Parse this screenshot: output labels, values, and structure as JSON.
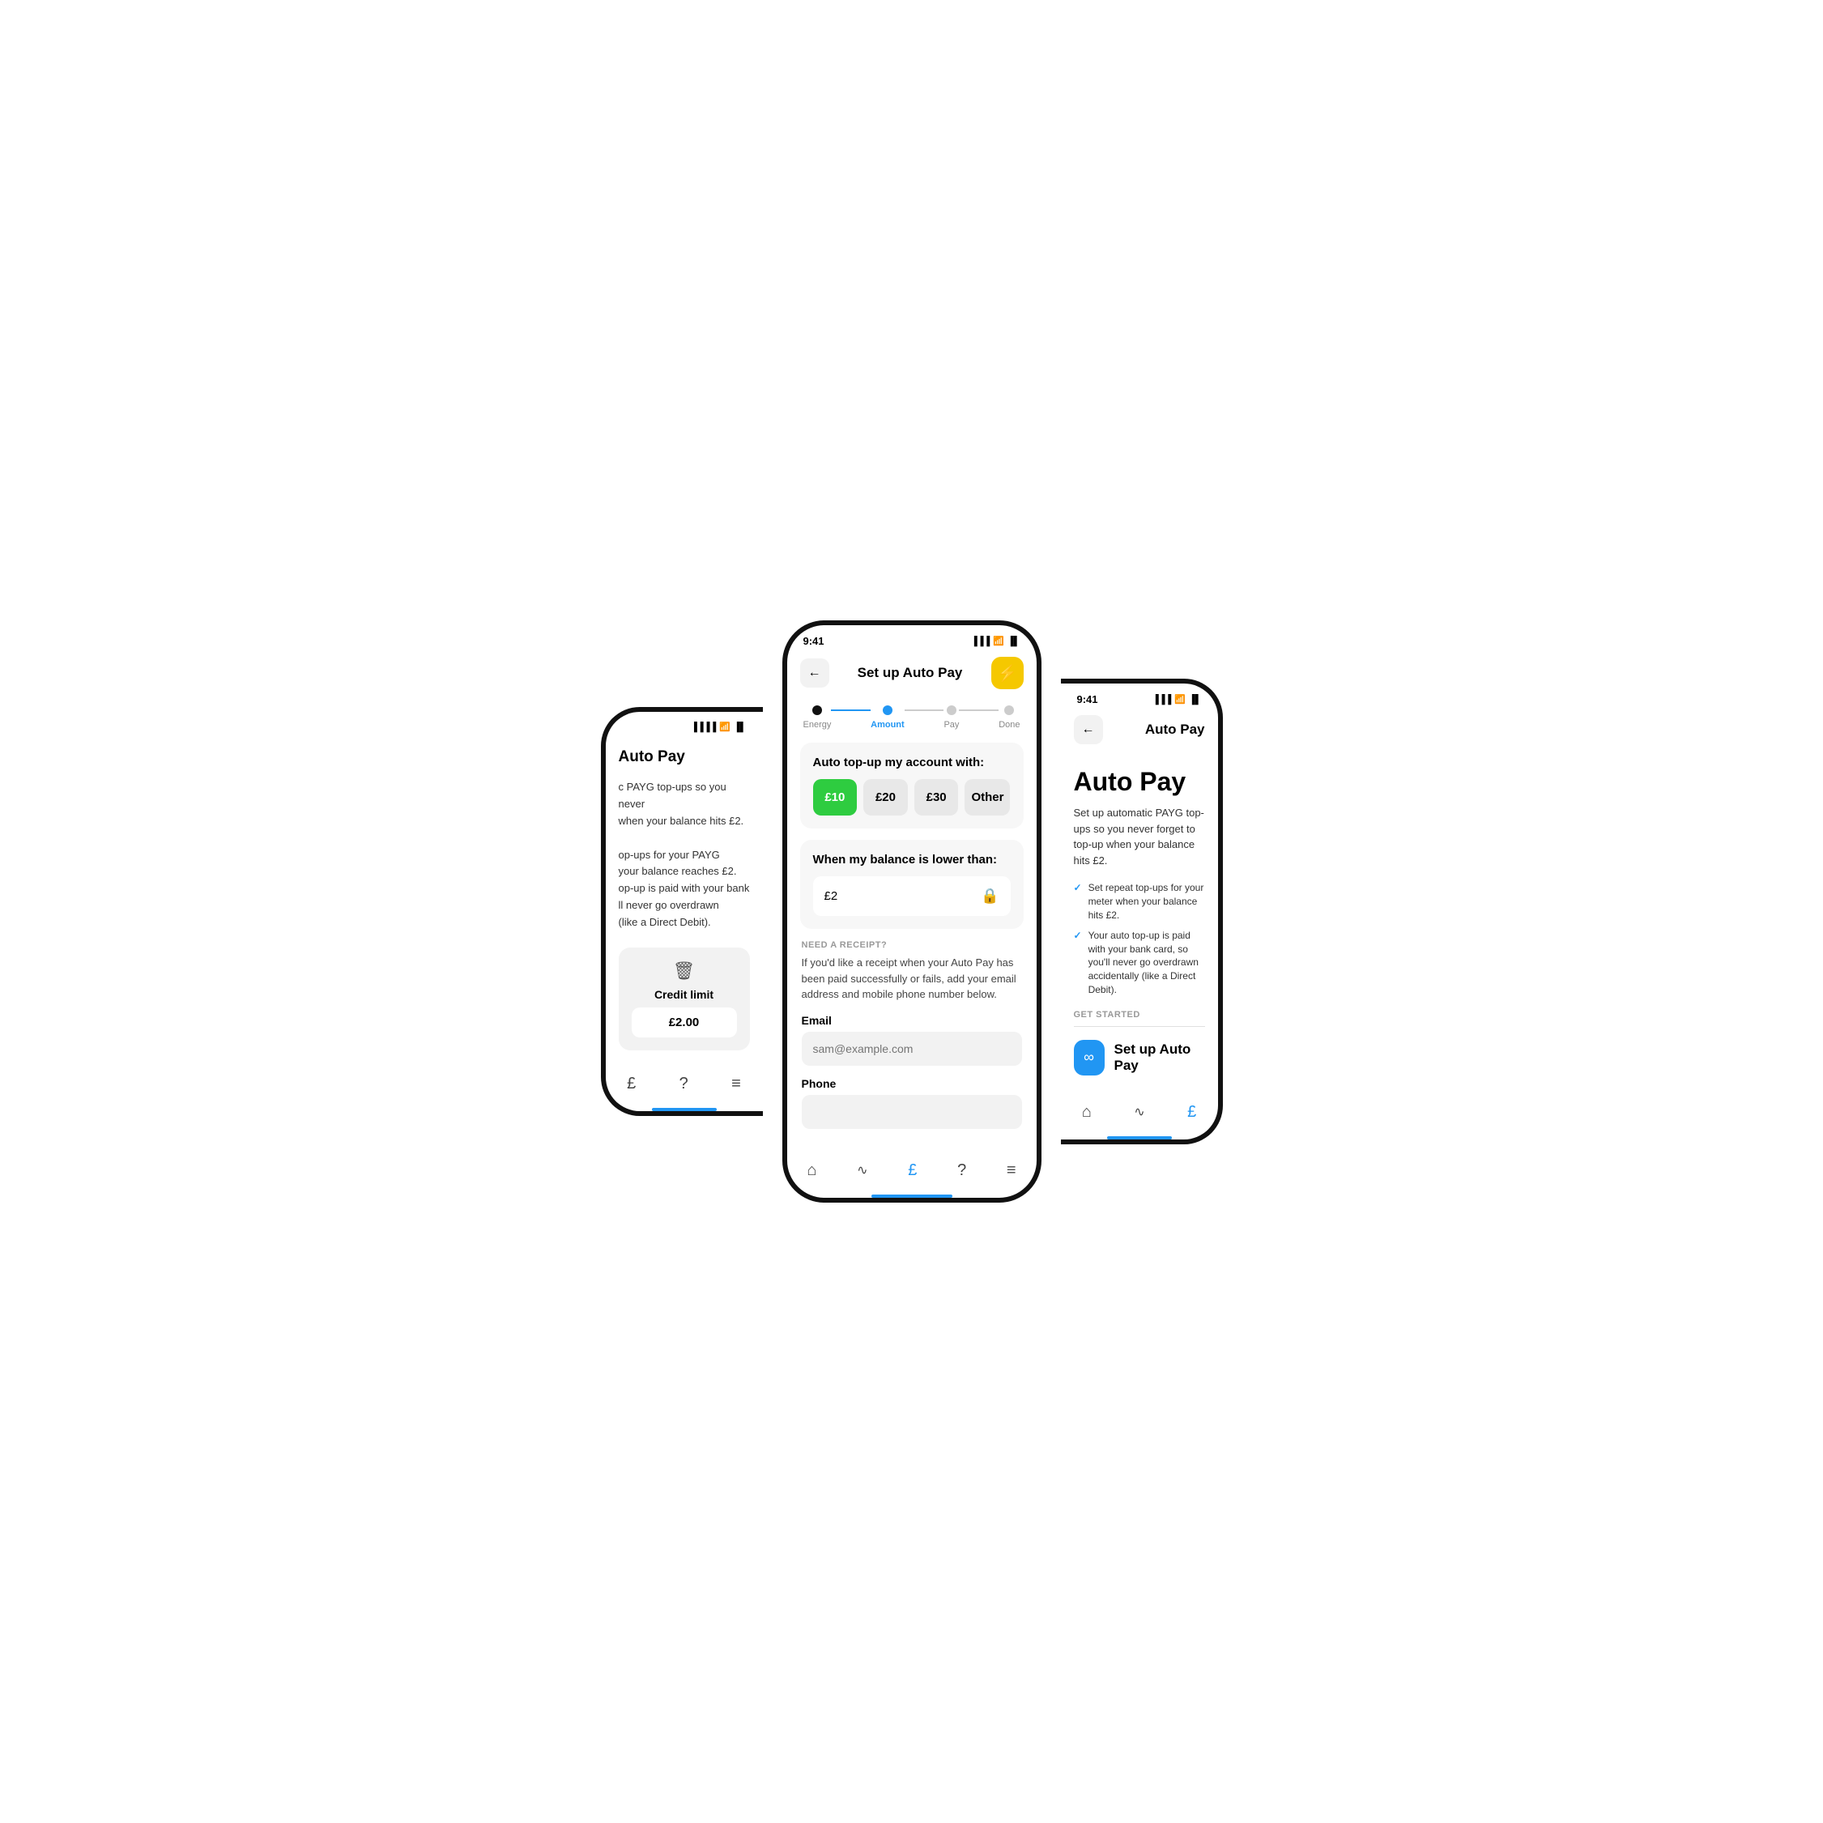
{
  "left_phone": {
    "title": "Auto Pay",
    "description_lines": [
      "c PAYG top-ups so you never",
      "when your balance hits £2.",
      "",
      "op-ups for your PAYG",
      "your balance reaches £2.",
      "op-up is paid with your bank",
      "ll never go overdrawn",
      "(like a Direct Debit)."
    ],
    "credit_limit_label": "Credit limit",
    "credit_value": "£2.00",
    "nav_icons": [
      "£",
      "?",
      "≡"
    ]
  },
  "center_phone": {
    "status_time": "9:41",
    "nav_title": "Set up Auto Pay",
    "back_label": "←",
    "flash_icon": "⚡",
    "stepper": {
      "steps": [
        {
          "label": "Energy",
          "state": "completed"
        },
        {
          "label": "Amount",
          "state": "active"
        },
        {
          "label": "Pay",
          "state": "upcoming"
        },
        {
          "label": "Done",
          "state": "upcoming"
        }
      ]
    },
    "card1": {
      "title": "Auto top-up my account with:",
      "amounts": [
        "£10",
        "£20",
        "£30",
        "Other"
      ],
      "selected_index": 0
    },
    "card2": {
      "title": "When my balance is lower than:",
      "value": "£2"
    },
    "receipt_section": {
      "label": "NEED A RECEIPT?",
      "description": "If you'd like a receipt when your Auto Pay has been paid successfully or fails, add your email address and mobile phone number below."
    },
    "email_field": {
      "label": "Email",
      "placeholder": "sam@example.com"
    },
    "phone_field": {
      "label": "Phone"
    },
    "nav_icons": [
      "🏠",
      "∿",
      "£",
      "?",
      "≡"
    ]
  },
  "right_phone": {
    "status_time": "9:41",
    "nav_title": "Auto Pay",
    "back_label": "←",
    "big_title": "Auto Pay",
    "description": "Set up automatic PAYG top-ups so you never forget to top-up when your balance hits £2.",
    "check_items": [
      "Set repeat top-ups for your meter when your balance hits £2.",
      "Your auto top-up is paid with your bank card, so you'll never go overdrawn accidentally (like a Direct Debit)."
    ],
    "get_started_label": "GET STARTED",
    "setup_btn_label": "Set up Auto Pay",
    "nav_icons": [
      "🏠",
      "∿",
      "£"
    ]
  },
  "colors": {
    "active_blue": "#2196f3",
    "selected_green": "#2ecc40",
    "yellow": "#f5c800",
    "border": "#111"
  }
}
